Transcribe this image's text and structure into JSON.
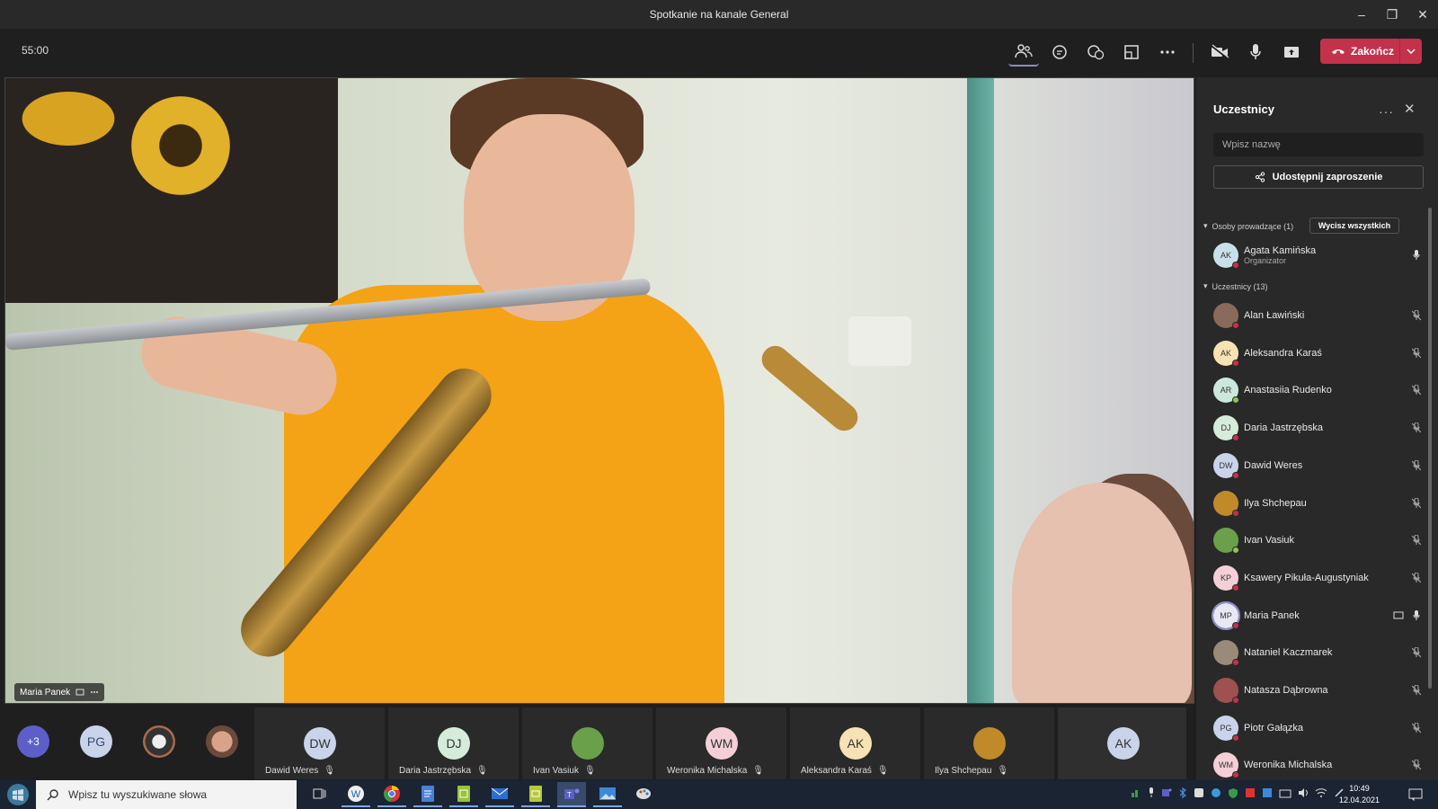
{
  "window": {
    "title": "Spotkanie na kanale General",
    "minimize": "–",
    "maximize": "❐",
    "close": "✕"
  },
  "toolbar": {
    "timer": "55:00",
    "end_label": "Zakończ"
  },
  "stage": {
    "speaker_name": "Maria Panek"
  },
  "strip": {
    "overflow": "+3",
    "first_avatar": "PG",
    "tiles": [
      {
        "initials": "DW",
        "name": "Dawid Weres",
        "color": "#c9d4ea"
      },
      {
        "initials": "DJ",
        "name": "Daria Jastrzębska",
        "color": "#d4ecd9"
      },
      {
        "initials": "",
        "name": "Ivan Vasiuk",
        "color": "#6aa04a"
      },
      {
        "initials": "WM",
        "name": "Weronika Michalska",
        "color": "#f4cfd8"
      },
      {
        "initials": "AK",
        "name": "Aleksandra Karaś",
        "color": "#f6e2b3"
      },
      {
        "initials": "",
        "name": "Ilya Shchepau",
        "color": "#c08a2a"
      }
    ],
    "last_avatar": "AK"
  },
  "panel": {
    "title": "Uczestnicy",
    "search_placeholder": "Wpisz nazwę",
    "share_label": "Udostępnij zaproszenie",
    "presenters_label": "Osoby prowadzące (1)",
    "mute_all_label": "Wycisz wszystkich",
    "attendees_label": "Uczestnicy (13)",
    "organizer": {
      "initials": "AK",
      "name": "Agata Kamińska",
      "role": "Organizator",
      "color": "#c9e0ea"
    },
    "attendees": [
      {
        "initials": "",
        "name": "Alan Ławiński",
        "color": "#8a6a5a"
      },
      {
        "initials": "AK",
        "name": "Aleksandra Karaś",
        "color": "#f6e2b3"
      },
      {
        "initials": "AR",
        "name": "Anastasiia Rudenko",
        "color": "#cbe8dc"
      },
      {
        "initials": "DJ",
        "name": "Daria Jastrzębska",
        "color": "#d4ecd9"
      },
      {
        "initials": "DW",
        "name": "Dawid Weres",
        "color": "#c9d4ea"
      },
      {
        "initials": "",
        "name": "Ilya Shchepau",
        "color": "#c08a2a"
      },
      {
        "initials": "",
        "name": "Ivan Vasiuk",
        "color": "#6aa04a"
      },
      {
        "initials": "KP",
        "name": "Ksawery Pikuła-Augustyniak",
        "color": "#f4cfd8"
      },
      {
        "initials": "MP",
        "name": "Maria Panek",
        "color": "#e8e8f4"
      },
      {
        "initials": "",
        "name": "Nataniel Kaczmarek",
        "color": "#9a8a7a"
      },
      {
        "initials": "",
        "name": "Natasza Dąbrowna",
        "color": "#a05050"
      },
      {
        "initials": "PG",
        "name": "Piotr Gałązka",
        "color": "#c9d4ea"
      },
      {
        "initials": "WM",
        "name": "Weronika Michalska",
        "color": "#f4cfd8"
      }
    ]
  },
  "taskbar": {
    "search_placeholder": "Wpisz tu wyszukiwane słowa",
    "time": "10:49",
    "date": "12.04.2021"
  }
}
